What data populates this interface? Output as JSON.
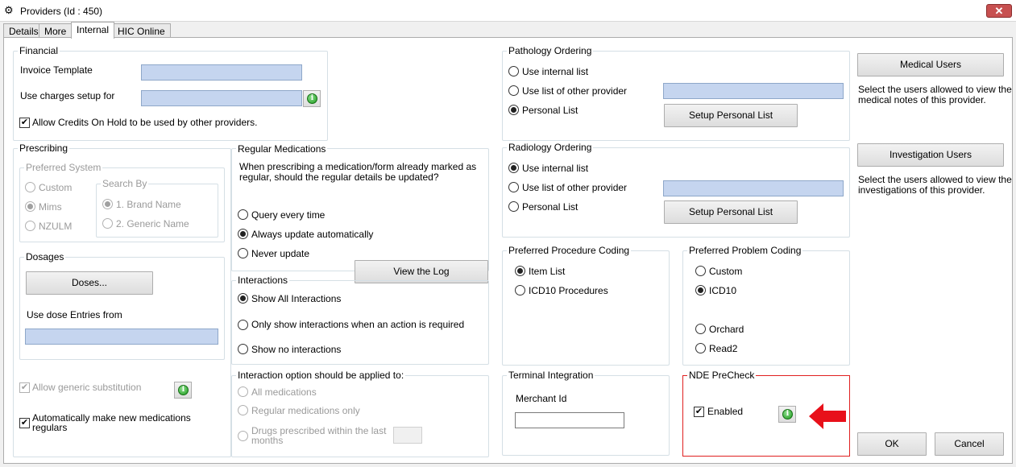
{
  "window": {
    "title": "Providers (Id : 450)",
    "close_glyph": "✕",
    "icon": "gear-icon"
  },
  "tabs": [
    {
      "label": "Details",
      "active": false
    },
    {
      "label": "More",
      "active": false
    },
    {
      "label": "Internal",
      "active": true
    },
    {
      "label": "HIC Online",
      "active": false
    }
  ],
  "financial": {
    "title": "Financial",
    "invoice_template_label": "Invoice Template",
    "invoice_template_value": "",
    "charges_label": "Use charges setup for",
    "charges_value": "",
    "allow_credits_label": "Allow Credits On Hold to be used by other providers.",
    "allow_credits_checked": true
  },
  "prescribing": {
    "title": "Prescribing",
    "preferred_system": {
      "title": "Preferred System",
      "options": [
        "Custom",
        "Mims",
        "NZULM"
      ],
      "selected": "Mims"
    },
    "search_by": {
      "title": "Search By",
      "options": [
        "1. Brand Name",
        "2. Generic Name"
      ],
      "selected": "1. Brand Name"
    },
    "dosages": {
      "title": "Dosages",
      "doses_button": "Doses...",
      "dose_entries_label": "Use dose Entries from",
      "dose_entries_value": ""
    },
    "allow_generic_label": "Allow generic substitution",
    "allow_generic_checked": true,
    "auto_regular_label_1": "Automatically make new medications",
    "auto_regular_label_2": "regulars",
    "auto_regular_checked": true
  },
  "regular_medications": {
    "title": "Regular Medications",
    "question_1": "When prescribing a medication/form already marked as",
    "question_2": "regular, should the regular details be updated?",
    "options": [
      "Query every time",
      "Always update automatically",
      "Never update"
    ],
    "selected": "Always update automatically",
    "view_log_button": "View the Log"
  },
  "interactions": {
    "title": "Interactions",
    "options": [
      "Show All Interactions",
      "Only show interactions when an action is required",
      "Show no interactions"
    ],
    "selected": "Show All Interactions"
  },
  "interaction_option": {
    "title": "Interaction option should be applied to:",
    "options": [
      "All medications",
      "Regular medications only"
    ],
    "drugs_within_1": "Drugs prescribed within the last",
    "drugs_within_2": "months",
    "months_value": ""
  },
  "pathology": {
    "title": "Pathology Ordering",
    "options": [
      "Use internal list",
      "Use list of other provider",
      "Personal List"
    ],
    "selected": "Personal List",
    "other_provider_value": "",
    "setup_button": "Setup Personal List"
  },
  "radiology": {
    "title": "Radiology Ordering",
    "options": [
      "Use internal list",
      "Use list of other provider",
      "Personal List"
    ],
    "selected": "Use internal list",
    "other_provider_value": "",
    "setup_button": "Setup Personal List"
  },
  "procedure_coding": {
    "title": "Preferred Procedure Coding",
    "options": [
      "Item List",
      "ICD10 Procedures"
    ],
    "selected": "Item List"
  },
  "problem_coding": {
    "title": "Preferred Problem Coding",
    "options": [
      "Custom",
      "ICD10",
      "Orchard",
      "Read2"
    ],
    "selected": "ICD10"
  },
  "terminal": {
    "title": "Terminal Integration",
    "merchant_label": "Merchant Id",
    "merchant_value": ""
  },
  "nde": {
    "title": "NDE PreCheck",
    "enabled_label": "Enabled",
    "enabled_checked": true
  },
  "medical_users": {
    "button": "Medical Users",
    "description_1": "Select the users allowed to view the",
    "description_2": "medical notes of this provider."
  },
  "investigation_users": {
    "button": "Investigation Users",
    "description_1": "Select the users allowed to view the",
    "description_2": "investigations of this provider."
  },
  "footer": {
    "ok": "OK",
    "cancel": "Cancel"
  },
  "colors": {
    "field_blue": "#c5d5ef",
    "highlight_red": "#e02020",
    "arrow_red": "#e8101a",
    "info_green": "#1c9a1c"
  }
}
